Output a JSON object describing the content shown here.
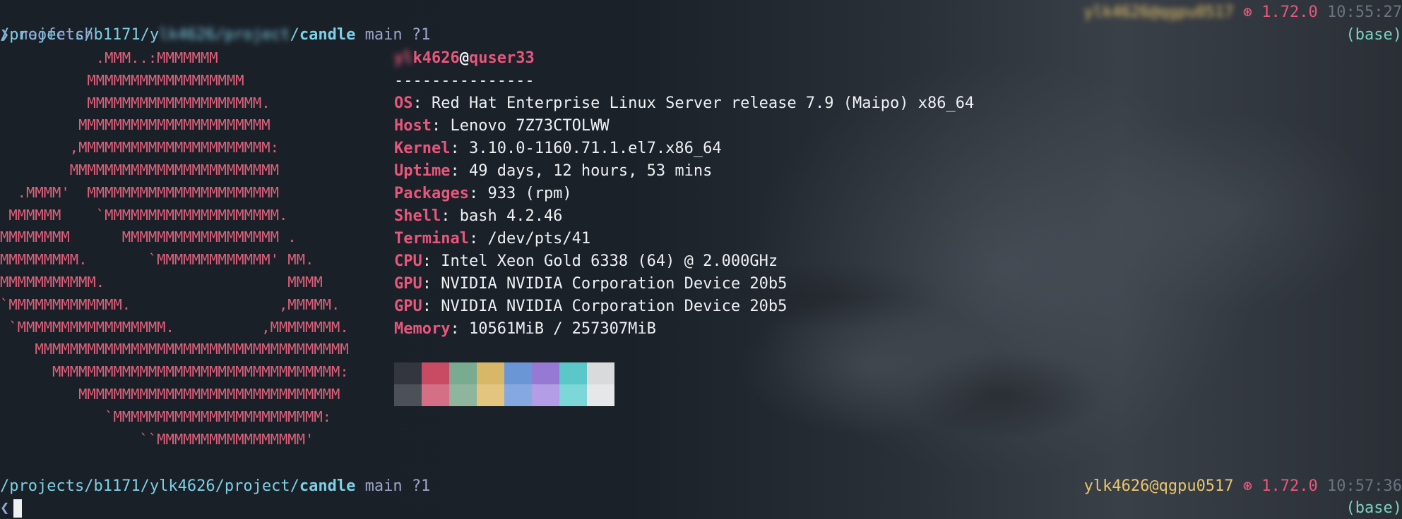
{
  "prompt_top": {
    "path_prefix": "/projects/b1171/y",
    "path_blurred": "lk4626/project",
    "path_sep": "/",
    "dir": "candle",
    "branch": "main",
    "status": "?1",
    "user_host_blurred": "ylk4626@qgpu0517",
    "ver_icon": "⊛",
    "version": "1.72.0",
    "time": "10:55:27",
    "env": "(base)"
  },
  "command": {
    "prompt_char": "❯",
    "text": "neofetch"
  },
  "ascii_art": [
    "           .MMM..:MMMMMMM",
    "          MMMMMMMMMMMMMMMMMM",
    "          MMMMMMMMMMMMMMMMMMMM.",
    "         MMMMMMMMMMMMMMMMMMMMMM",
    "        ,MMMMMMMMMMMMMMMMMMMMMM:",
    "        MMMMMMMMMMMMMMMMMMMMMMMM",
    "  .MMMM'  MMMMMMMMMMMMMMMMMMMMMM",
    " MMMMMM    `MMMMMMMMMMMMMMMMMMMM.",
    "MMMMMMMM      MMMMMMMMMMMMMMMMMM .",
    "MMMMMMMMM.       `MMMMMMMMMMMMM' MM.",
    "MMMMMMMMMMM.                     MMMM",
    "`MMMMMMMMMMMMM.                 ,MMMMM.",
    " `MMMMMMMMMMMMMMMMM.          ,MMMMMMMM.",
    "    MMMMMMMMMMMMMMMMMMMMMMMMMMMMMMMMMMMM",
    "      MMMMMMMMMMMMMMMMMMMMMMMMMMMMMMMMM:",
    "         MMMMMMMMMMMMMMMMMMMMMMMMMMMMMM",
    "            `MMMMMMMMMMMMMMMMMMMMMMMM:",
    "                ``MMMMMMMMMMMMMMMMM'"
  ],
  "info": {
    "user_blurred": "yl",
    "user_rest": "k4626",
    "at": "@",
    "host": "quser33",
    "dashes": "---------------",
    "rows": [
      {
        "key": "OS",
        "value": "Red Hat Enterprise Linux Server release 7.9 (Maipo) x86_64"
      },
      {
        "key": "Host",
        "value": "Lenovo 7Z73CTOLWW"
      },
      {
        "key": "Kernel",
        "value": "3.10.0-1160.71.1.el7.x86_64"
      },
      {
        "key": "Uptime",
        "value": "49 days, 12 hours, 53 mins"
      },
      {
        "key": "Packages",
        "value": "933 (rpm)"
      },
      {
        "key": "Shell",
        "value": "bash 4.2.46"
      },
      {
        "key": "Terminal",
        "value": "/dev/pts/41"
      },
      {
        "key": "CPU",
        "value": "Intel Xeon Gold 6338 (64) @ 2.000GHz"
      },
      {
        "key": "GPU",
        "value": "NVIDIA NVIDIA Corporation Device 20b5"
      },
      {
        "key": "GPU",
        "value": "NVIDIA NVIDIA Corporation Device 20b5"
      },
      {
        "key": "Memory",
        "value": "10561MiB / 257307MiB"
      }
    ],
    "separator": ": "
  },
  "palette": {
    "normal": [
      "#33363e",
      "#c94a63",
      "#78ab8f",
      "#d9b768",
      "#6b96d6",
      "#9679d2",
      "#5cc7c9",
      "#d9dadc"
    ],
    "bright": [
      "#4c5059",
      "#d46f85",
      "#8fb59e",
      "#e3c57f",
      "#86a8e0",
      "#b39de6",
      "#7dd6d8",
      "#e6e7e9"
    ]
  },
  "prompt_bottom": {
    "path_prefix": "/projects/b1171/ylk4626/project/",
    "dir": "candle",
    "branch": "main",
    "status": "?1",
    "user_host": "ylk4626@qgpu0517",
    "ver_icon": "⊛",
    "version": "1.72.0",
    "time": "10:57:36",
    "env": "(base)",
    "prompt_char": "❮"
  }
}
